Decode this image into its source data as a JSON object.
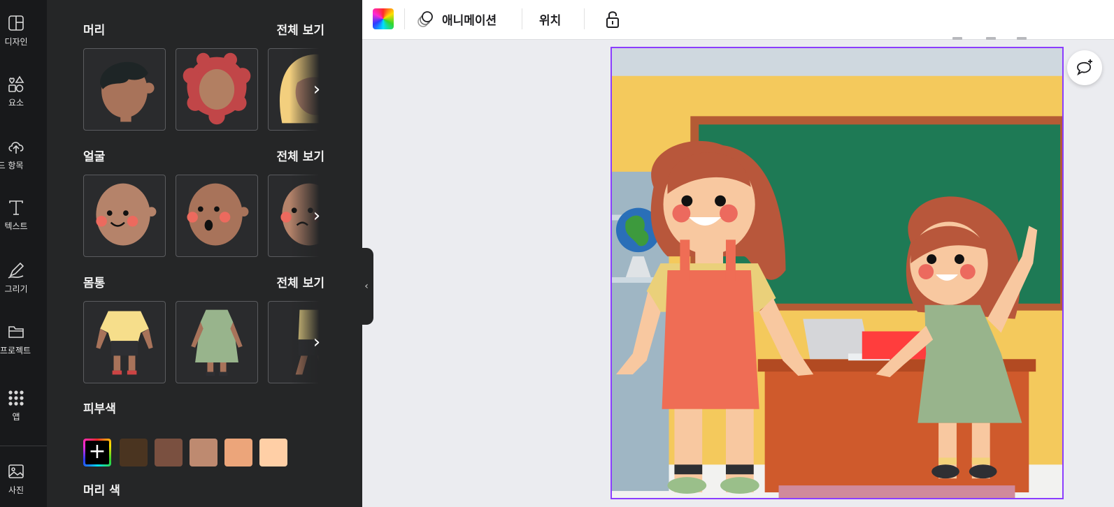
{
  "rail": {
    "items": [
      {
        "label": "디자인",
        "icon": "design-layout-icon"
      },
      {
        "label": "요소",
        "icon": "elements-shapes-icon"
      },
      {
        "label": "업로드 항목",
        "icon": "upload-cloud-icon"
      },
      {
        "label": "텍스트",
        "icon": "text-t-icon"
      },
      {
        "label": "그리기",
        "icon": "draw-pen-icon"
      },
      {
        "label": "프로젝트",
        "icon": "folder-icon"
      },
      {
        "label": "앱",
        "icon": "apps-grid-icon"
      },
      {
        "label": "사진",
        "icon": "photo-icon"
      }
    ]
  },
  "panel": {
    "sections": [
      {
        "title": "머리",
        "see_all": "전체 보기"
      },
      {
        "title": "얼굴",
        "see_all": "전체 보기"
      },
      {
        "title": "몸통",
        "see_all": "전체 보기"
      }
    ],
    "skin": {
      "title": "피부색",
      "swatches": [
        "#4a3420",
        "#7a5040",
        "#be8a70",
        "#eca57a",
        "#ffcfa6"
      ]
    },
    "hair_color_title": "머리 색"
  },
  "toolbar": {
    "animate_label": "애니메이션",
    "position_label": "위치"
  },
  "colors": {
    "accent": "#8b3dff",
    "panel_bg": "#252627",
    "rail_bg": "#18191b"
  }
}
